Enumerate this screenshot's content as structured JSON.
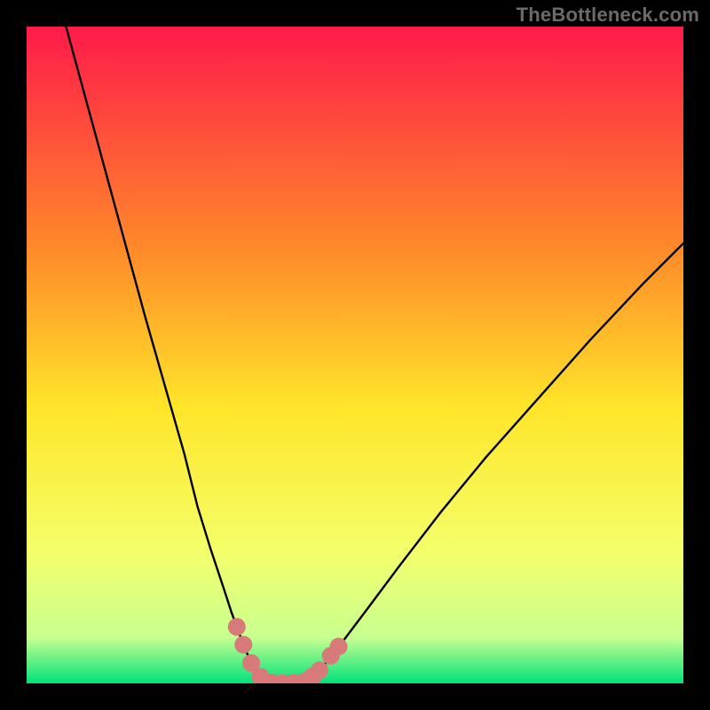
{
  "watermark": "TheBottleneck.com",
  "chart_data": {
    "type": "line",
    "title": "",
    "xlabel": "",
    "ylabel": "",
    "xlim": [
      0,
      100
    ],
    "ylim": [
      0,
      100
    ],
    "grid": false,
    "legend": false,
    "background_gradient": {
      "top": "#ff1a4a",
      "mid_upper": "#ff8a2a",
      "mid": "#ffe52a",
      "mid_lower": "#f4ff6a",
      "near_bottom": "#c8ff90",
      "bottom": "#00e27a"
    },
    "series": [
      {
        "name": "left_branch",
        "line": true,
        "x": [
          6,
          9,
          12,
          15,
          18,
          21,
          24,
          26,
          28,
          30,
          31.2,
          32.3,
          33.2,
          34.0,
          34.8,
          35.5,
          36.2
        ],
        "y": [
          100,
          89,
          78,
          67,
          56,
          45.5,
          35,
          27,
          20.5,
          14.5,
          10.8,
          7.8,
          5.4,
          3.6,
          2.2,
          1.2,
          0.4
        ]
      },
      {
        "name": "valley_floor",
        "line": true,
        "x": [
          36.2,
          37.5,
          39.0,
          40.5,
          42.0,
          43.2
        ],
        "y": [
          0.4,
          0.12,
          0.05,
          0.05,
          0.12,
          0.5
        ]
      },
      {
        "name": "right_branch",
        "line": true,
        "x": [
          43.2,
          45,
          48,
          52,
          57,
          63,
          70,
          78,
          86,
          94,
          100
        ],
        "y": [
          0.5,
          2.4,
          6.2,
          11.5,
          18.2,
          26.0,
          34.5,
          43.5,
          52.5,
          61.0,
          67.0
        ]
      }
    ],
    "markers": {
      "name": "highlight_points",
      "color": "#d97a7a",
      "radius": 10,
      "points": [
        {
          "x": 32.0,
          "y": 8.6
        },
        {
          "x": 33.0,
          "y": 5.9
        },
        {
          "x": 34.2,
          "y": 3.1
        },
        {
          "x": 35.6,
          "y": 1.0
        },
        {
          "x": 37.2,
          "y": 0.15
        },
        {
          "x": 38.9,
          "y": 0.05
        },
        {
          "x": 40.6,
          "y": 0.07
        },
        {
          "x": 42.3,
          "y": 0.28
        },
        {
          "x": 43.6,
          "y": 1.1
        },
        {
          "x": 44.6,
          "y": 2.0
        },
        {
          "x": 46.3,
          "y": 4.2
        },
        {
          "x": 47.5,
          "y": 5.6
        }
      ]
    }
  }
}
